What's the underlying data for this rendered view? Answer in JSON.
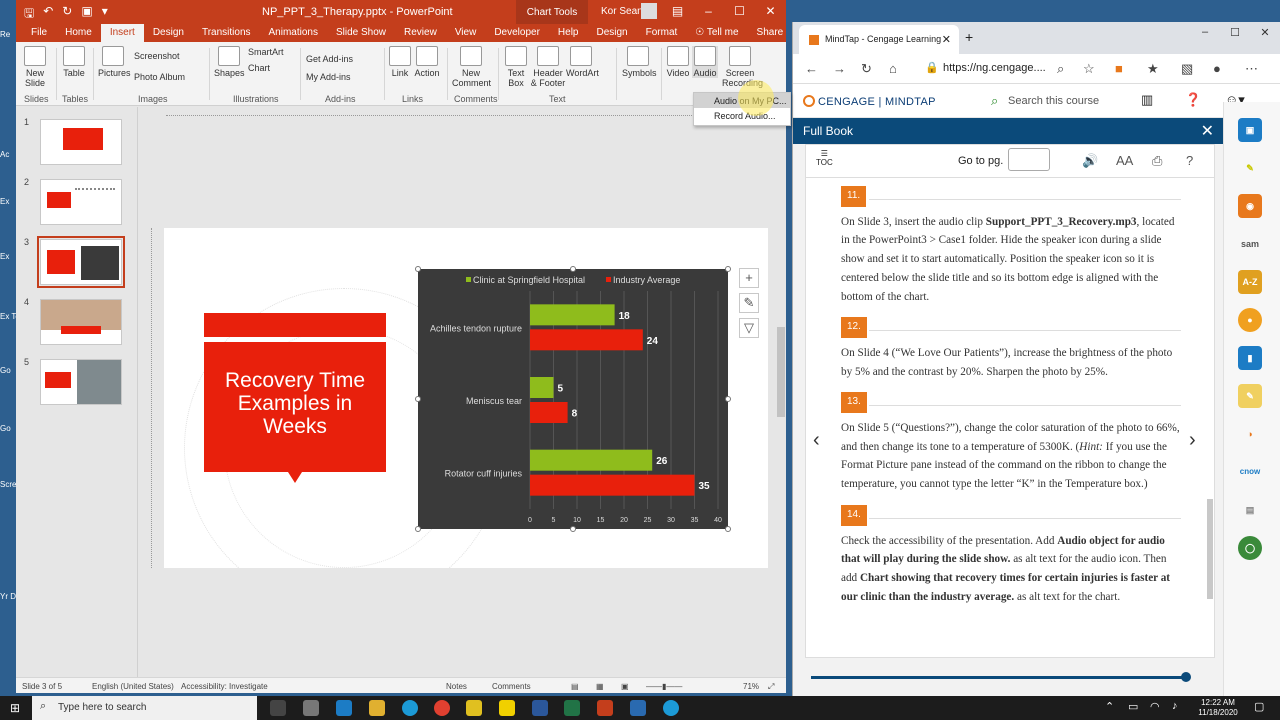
{
  "desktop": {
    "side_labels": [
      "Re",
      "Ac",
      "Ex",
      "Ex",
      "Ex Te",
      "Go",
      "Go",
      "Scre",
      "Yr Do"
    ]
  },
  "ppt": {
    "title": "NP_PPT_3_Therapy.pptx  -  PowerPoint",
    "chart_tools": "Chart Tools",
    "user": "Kor Sean",
    "tabs": [
      "File",
      "Home",
      "Insert",
      "Design",
      "Transitions",
      "Animations",
      "Slide Show",
      "Review",
      "View",
      "Developer",
      "Help",
      "Design",
      "Format"
    ],
    "tell_me": "Tell me",
    "share": "Share",
    "ribbon": {
      "new_slide": "New Slide",
      "table": "Table",
      "pictures": "Pictures",
      "screenshot": "Screenshot",
      "photo_album": "Photo Album",
      "shapes": "Shapes",
      "smartart": "SmartArt",
      "chart": "Chart",
      "get_addins": "Get Add-ins",
      "my_addins": "My Add-ins",
      "link": "Link",
      "action": "Action",
      "new_comment": "New Comment",
      "text_box": "Text Box",
      "header_footer": "Header & Footer",
      "wordart": "WordArt",
      "symbols": "Symbols",
      "video": "Video",
      "audio": "Audio",
      "screen_recording": "Screen Recording",
      "groups": [
        "Slides",
        "Tables",
        "Images",
        "Illustrations",
        "Add-ins",
        "Links",
        "Comments",
        "Text"
      ]
    },
    "audio_menu": [
      "Audio on My PC...",
      "Record Audio..."
    ],
    "slide_numbers": [
      "1",
      "2",
      "3",
      "4",
      "5"
    ],
    "slide_text": "Recovery Time Examples in Weeks",
    "status": {
      "slide": "Slide 3 of 5",
      "lang": "English (United States)",
      "access": "Accessibility: Investigate",
      "notes": "Notes",
      "comments": "Comments",
      "zoom": "71%"
    }
  },
  "chart_data": {
    "type": "bar",
    "categories": [
      "Achilles tendon rupture",
      "Meniscus tear",
      "Rotator cuff injuries"
    ],
    "series": [
      {
        "name": "Clinic at Springfield Hospital",
        "values": [
          18,
          5,
          26
        ],
        "color": "#8fbc1c"
      },
      {
        "name": "Industry Average",
        "values": [
          24,
          8,
          35
        ],
        "color": "#e8200c"
      }
    ],
    "xlim": [
      0,
      40
    ],
    "xticks": [
      "0",
      "5",
      "10",
      "15",
      "20",
      "25",
      "30",
      "35",
      "40"
    ]
  },
  "browser": {
    "tab_title": "MindTap - Cengage Learning",
    "url": "https://ng.cengage....",
    "logo": "CENGAGE | MINDTAP",
    "search": "Search this course",
    "panel_title": "Full Book",
    "toc": "TOC",
    "goto": "Go to pg.",
    "steps": [
      {
        "num": "11.",
        "html": "On Slide 3, insert the audio clip <b>Support_PPT_3_Recovery.mp3</b>, located in the PowerPoint3 &gt; Case1 folder. Hide the speaker icon during a slide show and set it to start automatically. Position the speaker icon so it is centered below the slide title and so its bottom edge is aligned with the bottom of the chart."
      },
      {
        "num": "12.",
        "html": "On Slide 4 (“We Love Our Patients”), increase the brightness of the photo by 5% and the contrast by 20%. Sharpen the photo by 25%."
      },
      {
        "num": "13.",
        "html": "On Slide 5 (“Questions?”), change the color saturation of the photo to 66%, and then change its tone to a temperature of 5300K. (<i>Hint:</i> If you use the Format Picture pane instead of the command on the ribbon to change the temperature, you cannot type the letter “K” in the Temperature box.)"
      },
      {
        "num": "14.",
        "html": "Check the accessibility of the presentation. Add <b>Audio object for audio that will play during the slide show.</b> as alt text for the audio icon. Then add <b>Chart showing that recovery times for certain injuries is faster at our clinic than the industry average.</b> as alt text for the chart."
      }
    ],
    "apps": [
      "sam",
      "A-Z",
      "cnow"
    ]
  },
  "taskbar": {
    "search": "Type here to search",
    "time": "12:22 AM",
    "date": "11/18/2020"
  }
}
